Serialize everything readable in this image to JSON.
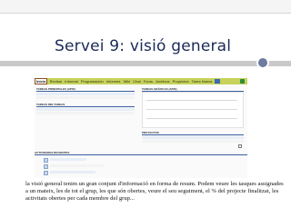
{
  "slide": {
    "title": "Servei 9: visió general",
    "caption": "la visió general tenim un gran conjunt d'informació en forma de resum. Podem veure les tasques assignades a un mateix, les de tot el grup, les que són obertes, veure el seu seguiment, el % del projecte finalitzat, les activitats obertes per cada membre del grup..."
  },
  "screenshot": {
    "tabs": [
      {
        "label": "Inicio",
        "active": true
      },
      {
        "label": "Revisar",
        "active": false
      },
      {
        "label": "Informal",
        "active": false
      },
      {
        "label": "Programación",
        "active": false
      },
      {
        "label": "Informes",
        "active": false
      },
      {
        "label": "Wiki",
        "active": false
      },
      {
        "label": "Chat",
        "active": false
      },
      {
        "label": "Foros",
        "active": false
      },
      {
        "label": "Archivos",
        "active": false
      },
      {
        "label": "Proyectos",
        "active": false
      },
      {
        "label": "Tarea Nueva",
        "active": false
      }
    ],
    "panels": {
      "tareas_principales": "TAREAS PRINCIPALES (APIS)",
      "tareas_graficas": "TAREAS GRÁFICAS (APIS)",
      "tareas_mis_tareas": "TAREAS MIS TAREAS",
      "proyectos": "PROYECTOS",
      "actividades_recientes": "ACTIVIDADES RECIENTES"
    }
  },
  "colors": {
    "title": "#1a2a57",
    "tab_bar": "#c8d25c",
    "accent_circle": "#6d7ba1",
    "deco_bar": "#c9c9c9"
  }
}
